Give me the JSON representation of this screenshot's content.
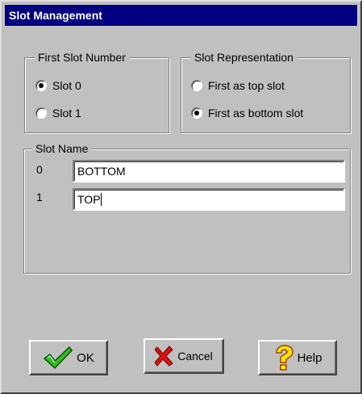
{
  "window": {
    "title": "Slot Management"
  },
  "first_slot_number": {
    "legend": "First Slot Number",
    "options": [
      {
        "label": "Slot 0",
        "checked": true
      },
      {
        "label": "Slot 1",
        "checked": false
      }
    ]
  },
  "slot_representation": {
    "legend": "Slot Representation",
    "options": [
      {
        "label": "First as top slot",
        "checked": false
      },
      {
        "label": "First as bottom slot",
        "checked": true
      }
    ]
  },
  "slot_name": {
    "legend": "Slot Name",
    "rows": [
      {
        "index": "0",
        "value": "BOTTOM"
      },
      {
        "index": "1",
        "value": "TOP"
      }
    ]
  },
  "buttons": {
    "ok": {
      "label": "OK",
      "icon": "checkmark-icon"
    },
    "cancel": {
      "label": "Cancel",
      "icon": "red-x-icon"
    },
    "help": {
      "label": "Help",
      "icon": "question-mark-icon"
    }
  }
}
